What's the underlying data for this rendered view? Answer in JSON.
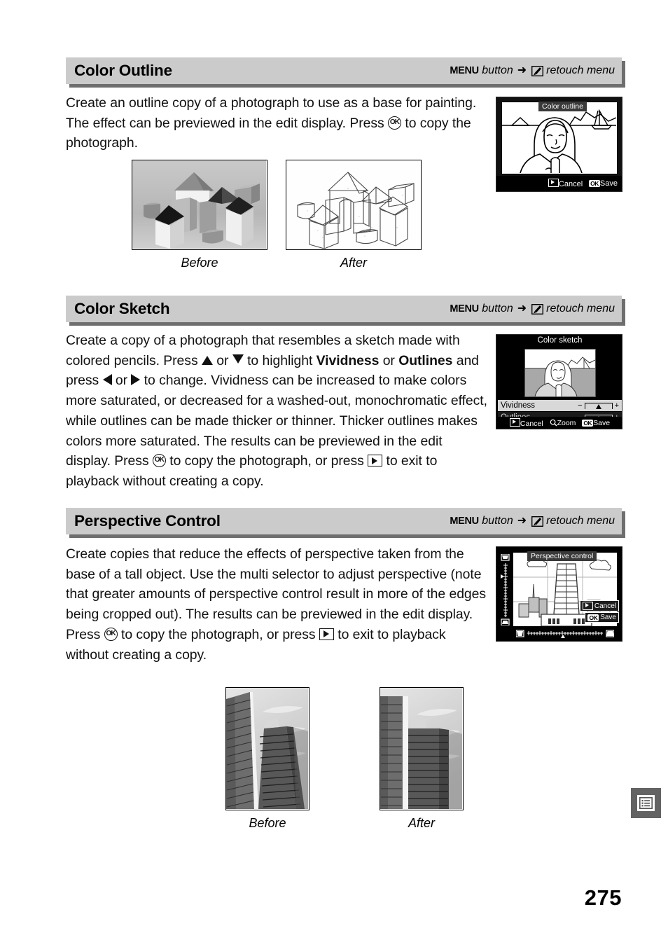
{
  "page": {
    "number": "275",
    "tab_icon": "menu-list-icon"
  },
  "colors": {
    "header_bar": "#cbcbcb",
    "header_shadow": "#6e6e6e",
    "tab_gray": "#636363",
    "lcd_black": "#000000"
  },
  "sections": [
    {
      "id": "color-outline",
      "title": "Color Outline",
      "path": {
        "button": "MENU",
        "button_word": "button",
        "arrow": "➜",
        "menu_icon": "retouch-menu-icon",
        "menu": "retouch menu"
      },
      "body_parts": [
        {
          "t": "text",
          "v": "Create an outline copy of a photograph to use as a base for painting.  The effect can be previewed in the edit display.  Press "
        },
        {
          "t": "ok"
        },
        {
          "t": "text",
          "v": " to copy the photograph."
        }
      ],
      "lcd": {
        "title": "Color outline",
        "footer": [
          {
            "key": "playback-icon",
            "label": "Cancel"
          },
          {
            "key": "ok-icon",
            "label": "Save"
          }
        ]
      },
      "figures": [
        {
          "caption": "Before",
          "alt": "photograph of wooden building blocks"
        },
        {
          "caption": "After",
          "alt": "color outline sketch of wooden building blocks"
        }
      ]
    },
    {
      "id": "color-sketch",
      "title": "Color Sketch",
      "path": {
        "button": "MENU",
        "button_word": "button",
        "arrow": "➜",
        "menu_icon": "retouch-menu-icon",
        "menu": "retouch menu"
      },
      "body_parts": [
        {
          "t": "text",
          "v": "Create a copy of a photograph that resembles a sketch made with colored pencils.  Press "
        },
        {
          "t": "up"
        },
        {
          "t": "text",
          "v": " or "
        },
        {
          "t": "down"
        },
        {
          "t": "text",
          "v": " to highlight "
        },
        {
          "t": "bold",
          "v": "Vividness"
        },
        {
          "t": "text",
          "v": " or "
        },
        {
          "t": "bold",
          "v": "Outlines"
        },
        {
          "t": "text",
          "v": " and press "
        },
        {
          "t": "left"
        },
        {
          "t": "text",
          "v": " or "
        },
        {
          "t": "right"
        },
        {
          "t": "text",
          "v": " to change.  Vividness can be increased to make colors more saturated, or decreased for a washed-out, monochromatic effect, while outlines can be made thicker or thinner.  Thicker outlines makes colors more saturated.  The results can be previewed in the edit display.  Press "
        },
        {
          "t": "ok"
        },
        {
          "t": "text",
          "v": " to copy the photograph, or press "
        },
        {
          "t": "play"
        },
        {
          "t": "text",
          "v": " to exit to playback without creating a copy."
        }
      ],
      "lcd": {
        "title": "Color sketch",
        "rows": [
          {
            "label": "Vividness",
            "selected": true,
            "minus": "−",
            "plus": "+"
          },
          {
            "label": "Outlines",
            "selected": false,
            "minus": "−",
            "plus": "+"
          }
        ],
        "footer": [
          {
            "key": "playback-icon",
            "label": "Cancel"
          },
          {
            "key": "zoom-icon",
            "label": "Zoom"
          },
          {
            "key": "ok-icon",
            "label": "Save"
          }
        ]
      }
    },
    {
      "id": "perspective-control",
      "title": "Perspective Control",
      "path": {
        "button": "MENU",
        "button_word": "button",
        "arrow": "➜",
        "menu_icon": "retouch-menu-icon",
        "menu": "retouch menu"
      },
      "body_parts": [
        {
          "t": "text",
          "v": "Create copies that reduce the effects of perspective taken from the base of a tall object.  Use the multi selector to adjust perspective (note that greater amounts of perspective control result in more of the edges being cropped out).  The results can be previewed in the edit display.  Press "
        },
        {
          "t": "ok"
        },
        {
          "t": "text",
          "v": " to copy the photograph, or press "
        },
        {
          "t": "play"
        },
        {
          "t": "text",
          "v": " to exit to playback without creating a copy."
        }
      ],
      "lcd": {
        "title": "Perspective control",
        "footer": [
          {
            "key": "playback-icon",
            "label": "Cancel"
          },
          {
            "key": "ok-icon",
            "label": "Save"
          }
        ]
      },
      "figures": [
        {
          "caption": "Before",
          "alt": "photograph of tall buildings with converging verticals"
        },
        {
          "caption": "After",
          "alt": "photograph of tall buildings with corrected verticals"
        }
      ]
    }
  ]
}
